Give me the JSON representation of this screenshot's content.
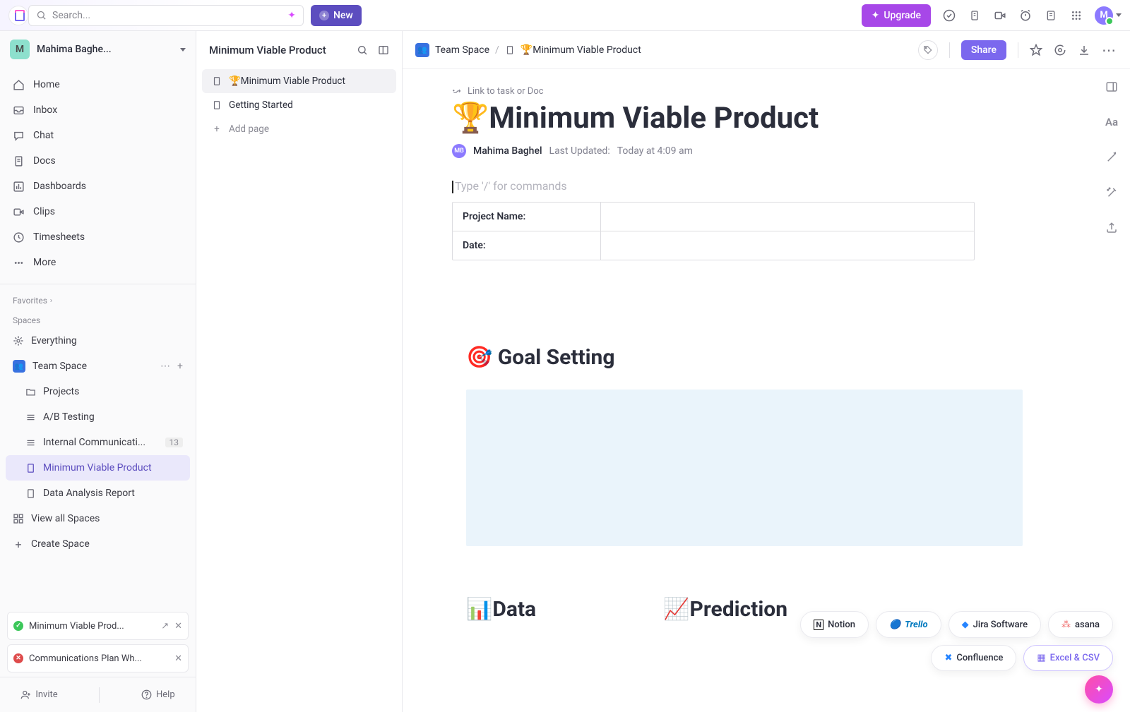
{
  "topbar": {
    "search_placeholder": "Search...",
    "new_label": "New",
    "upgrade_label": "Upgrade",
    "avatar_initial": "M"
  },
  "workspace": {
    "initial": "M",
    "name": "Mahima Baghe..."
  },
  "nav": {
    "home": "Home",
    "inbox": "Inbox",
    "chat": "Chat",
    "docs": "Docs",
    "dashboards": "Dashboards",
    "clips": "Clips",
    "timesheets": "Timesheets",
    "more": "More"
  },
  "sections": {
    "favorites": "Favorites",
    "spaces": "Spaces"
  },
  "spaces": {
    "everything": "Everything",
    "team_space": "Team Space",
    "projects": "Projects",
    "ab_testing": "A/B Testing",
    "internal_comm": "Internal Communicati...",
    "internal_comm_count": "13",
    "mvp": "Minimum Viable Product",
    "data_analysis": "Data Analysis Report",
    "view_all": "View all Spaces",
    "create": "Create Space"
  },
  "popovers": {
    "mvp": "Minimum Viable Prod...",
    "comms": "Communications Plan Wh..."
  },
  "footer": {
    "invite": "Invite",
    "help": "Help"
  },
  "midcol": {
    "title": "Minimum Viable Product",
    "items": [
      "🏆Minimum Viable Product",
      "Getting Started"
    ],
    "add": "Add page"
  },
  "breadcrumb": {
    "space": "Team Space",
    "page": "🏆Minimum Viable Product",
    "share": "Share"
  },
  "doc": {
    "link_hint": "Link to task or Doc",
    "title": "🏆Minimum Viable Product",
    "author_initials": "MB",
    "author": "Mahima Baghel",
    "updated_label": "Last Updated:",
    "updated_value": "Today at 4:09 am",
    "command_hint": "Type '/' for commands",
    "table": {
      "project_name": "Project Name:",
      "date": "Date:"
    },
    "goal_heading": "🎯 Goal Setting",
    "data_heading": "📊Data",
    "prediction_heading": "📈Prediction"
  },
  "integrations": {
    "notion": "Notion",
    "trello": "Trello",
    "jira": "Jira Software",
    "asana": "asana",
    "confluence": "Confluence",
    "excel": "Excel & CSV"
  }
}
